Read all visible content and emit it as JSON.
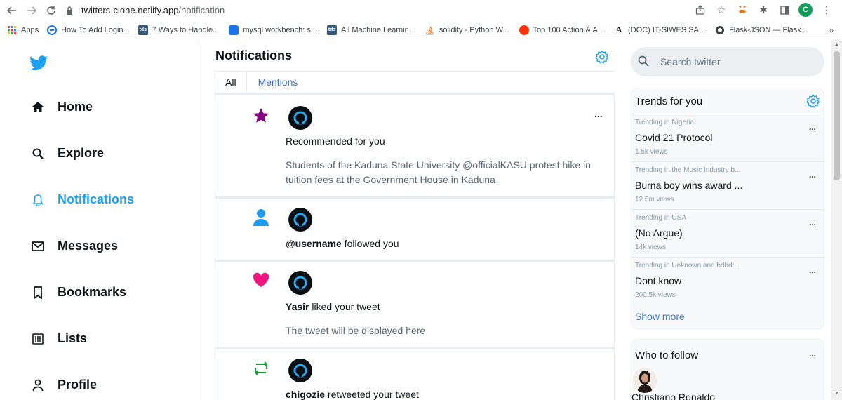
{
  "browser": {
    "url_host": "twitters-clone.netlify.app",
    "url_path": "/notification",
    "profile_initial": "C",
    "bookmarks": [
      {
        "label": "Apps",
        "icon": "apps-grid-icon"
      },
      {
        "label": "How To Add Login...",
        "icon": "bookmark-favicon-icon"
      },
      {
        "label": "7 Ways to Handle...",
        "icon": "tds-favicon-icon"
      },
      {
        "label": "mysql workbench: s...",
        "icon": "mysql-favicon-icon"
      },
      {
        "label": "All Machine Learnin...",
        "icon": "tds-favicon-icon"
      },
      {
        "label": "solidity - Python W...",
        "icon": "stackoverflow-favicon-icon"
      },
      {
        "label": "Top 100 Action & A...",
        "icon": "tomato-favicon-icon"
      },
      {
        "label": "(DOC) IT-SIWES SA...",
        "icon": "academia-favicon-icon"
      },
      {
        "label": "Flask-JSON — Flask...",
        "icon": "flask-favicon-icon"
      }
    ],
    "more_bookmarks": "»"
  },
  "sidebar": {
    "items": [
      {
        "label": "Home",
        "icon": "home-icon"
      },
      {
        "label": "Explore",
        "icon": "search-icon"
      },
      {
        "label": "Notifications",
        "icon": "bell-icon"
      },
      {
        "label": "Messages",
        "icon": "envelope-icon"
      },
      {
        "label": "Bookmarks",
        "icon": "bookmark-icon"
      },
      {
        "label": "Lists",
        "icon": "list-icon"
      },
      {
        "label": "Profile",
        "icon": "user-icon"
      }
    ]
  },
  "main": {
    "title": "Notifications",
    "tabs": {
      "all": "All",
      "mentions": "Mentions"
    },
    "notifications": [
      {
        "kind": "star-icon",
        "line": "Recommended for you",
        "body": "Students of the Kaduna State University @officialKASU protest hike in tuition fees at the Government House in Kaduna",
        "more": "..."
      },
      {
        "kind": "person-icon",
        "user": "@username",
        "action": " followed you"
      },
      {
        "kind": "heart-icon",
        "user": "Yasir",
        "action": " liked your tweet",
        "body": "The tweet will be displayed here"
      },
      {
        "kind": "retweet-icon",
        "user": "chigozie",
        "action": " retweeted your tweet"
      }
    ]
  },
  "right": {
    "search_placeholder": "Search twitter",
    "trends_title": "Trends for you",
    "trends": [
      {
        "context": "Trending in Nigeria",
        "name": "Covid 21 Protocol",
        "views": "1.5k views",
        "more": "..."
      },
      {
        "context": "Trending in the Music Industry b...",
        "name": "Burna boy wins award ...",
        "views": "12.5m views",
        "more": "..."
      },
      {
        "context": "Trending in USA",
        "name": "(No Argue)",
        "views": "14k views",
        "more": "..."
      },
      {
        "context": "Trending in Unknown ano bdhdi...",
        "name": "Dont know",
        "views": "200.5k views",
        "more": "..."
      }
    ],
    "show_more": "Show more",
    "follow_title": "Who to follow",
    "follow_more": "...",
    "follow_name": "Christiano Ronaldo"
  },
  "colors": {
    "accent": "#1da1f2",
    "link": "#3b73c8",
    "star": "#800080",
    "heart": "#f0147f",
    "retweet": "#17a035"
  }
}
